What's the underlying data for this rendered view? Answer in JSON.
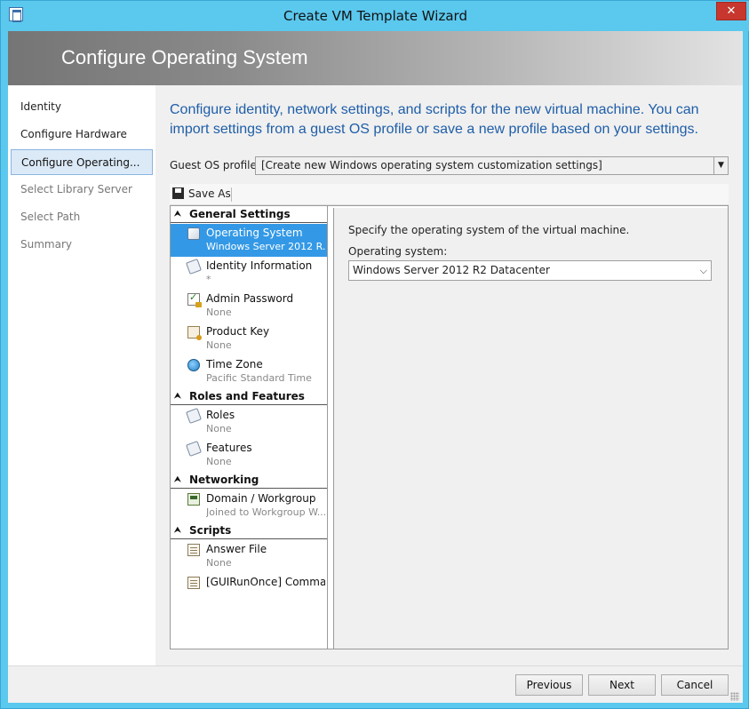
{
  "window": {
    "title": "Create VM Template Wizard",
    "close_glyph": "✕"
  },
  "banner": {
    "title": "Configure Operating System"
  },
  "nav": {
    "items": [
      {
        "label": "Identity",
        "state": "normal"
      },
      {
        "label": "Configure Hardware",
        "state": "normal"
      },
      {
        "label": "Configure Operating...",
        "state": "active"
      },
      {
        "label": "Select Library Server",
        "state": "disabled"
      },
      {
        "label": "Select Path",
        "state": "disabled"
      },
      {
        "label": "Summary",
        "state": "disabled"
      }
    ]
  },
  "main": {
    "description": "Configure identity, network settings, and scripts for the new virtual machine. You can import settings from a guest OS profile or save a new profile based on your settings.",
    "profile_label": "Guest OS profile:",
    "profile_value": "[Create new Windows operating system customization settings]",
    "toolbar": {
      "save_as_label": "Save As"
    }
  },
  "tree": {
    "sections": [
      {
        "title": "General Settings"
      },
      {
        "title": "Roles and Features"
      },
      {
        "title": "Networking"
      },
      {
        "title": "Scripts"
      }
    ],
    "items": [
      {
        "title": "Operating System",
        "subtitle": "Windows Server 2012 R...",
        "icon": "operating-system-icon",
        "selected": true
      },
      {
        "title": "Identity Information",
        "subtitle": "*",
        "icon": "identity-icon"
      },
      {
        "title": "Admin Password",
        "subtitle": "None",
        "icon": "admin-password-icon"
      },
      {
        "title": "Product Key",
        "subtitle": "None",
        "icon": "product-key-icon"
      },
      {
        "title": "Time Zone",
        "subtitle": "Pacific Standard Time",
        "icon": "time-zone-icon"
      },
      {
        "title": "Roles",
        "subtitle": "None",
        "icon": "roles-icon"
      },
      {
        "title": "Features",
        "subtitle": "None",
        "icon": "features-icon"
      },
      {
        "title": "Domain / Workgroup",
        "subtitle": "Joined to Workgroup W...",
        "icon": "domain-icon"
      },
      {
        "title": "Answer File",
        "subtitle": "None",
        "icon": "answer-file-icon"
      },
      {
        "title": "[GUIRunOnce] Comma...",
        "subtitle": "",
        "icon": "script-icon"
      }
    ]
  },
  "detail": {
    "description": "Specify the operating system of the virtual machine.",
    "os_label": "Operating system:",
    "os_value": "Windows Server 2012 R2 Datacenter"
  },
  "footer": {
    "previous_label": "Previous",
    "next_label": "Next",
    "cancel_label": "Cancel"
  },
  "colors": {
    "titlebar": "#5bc8ee",
    "selection": "#3399e6",
    "description_text": "#1f5ea8",
    "close_button": "#c7372e"
  }
}
